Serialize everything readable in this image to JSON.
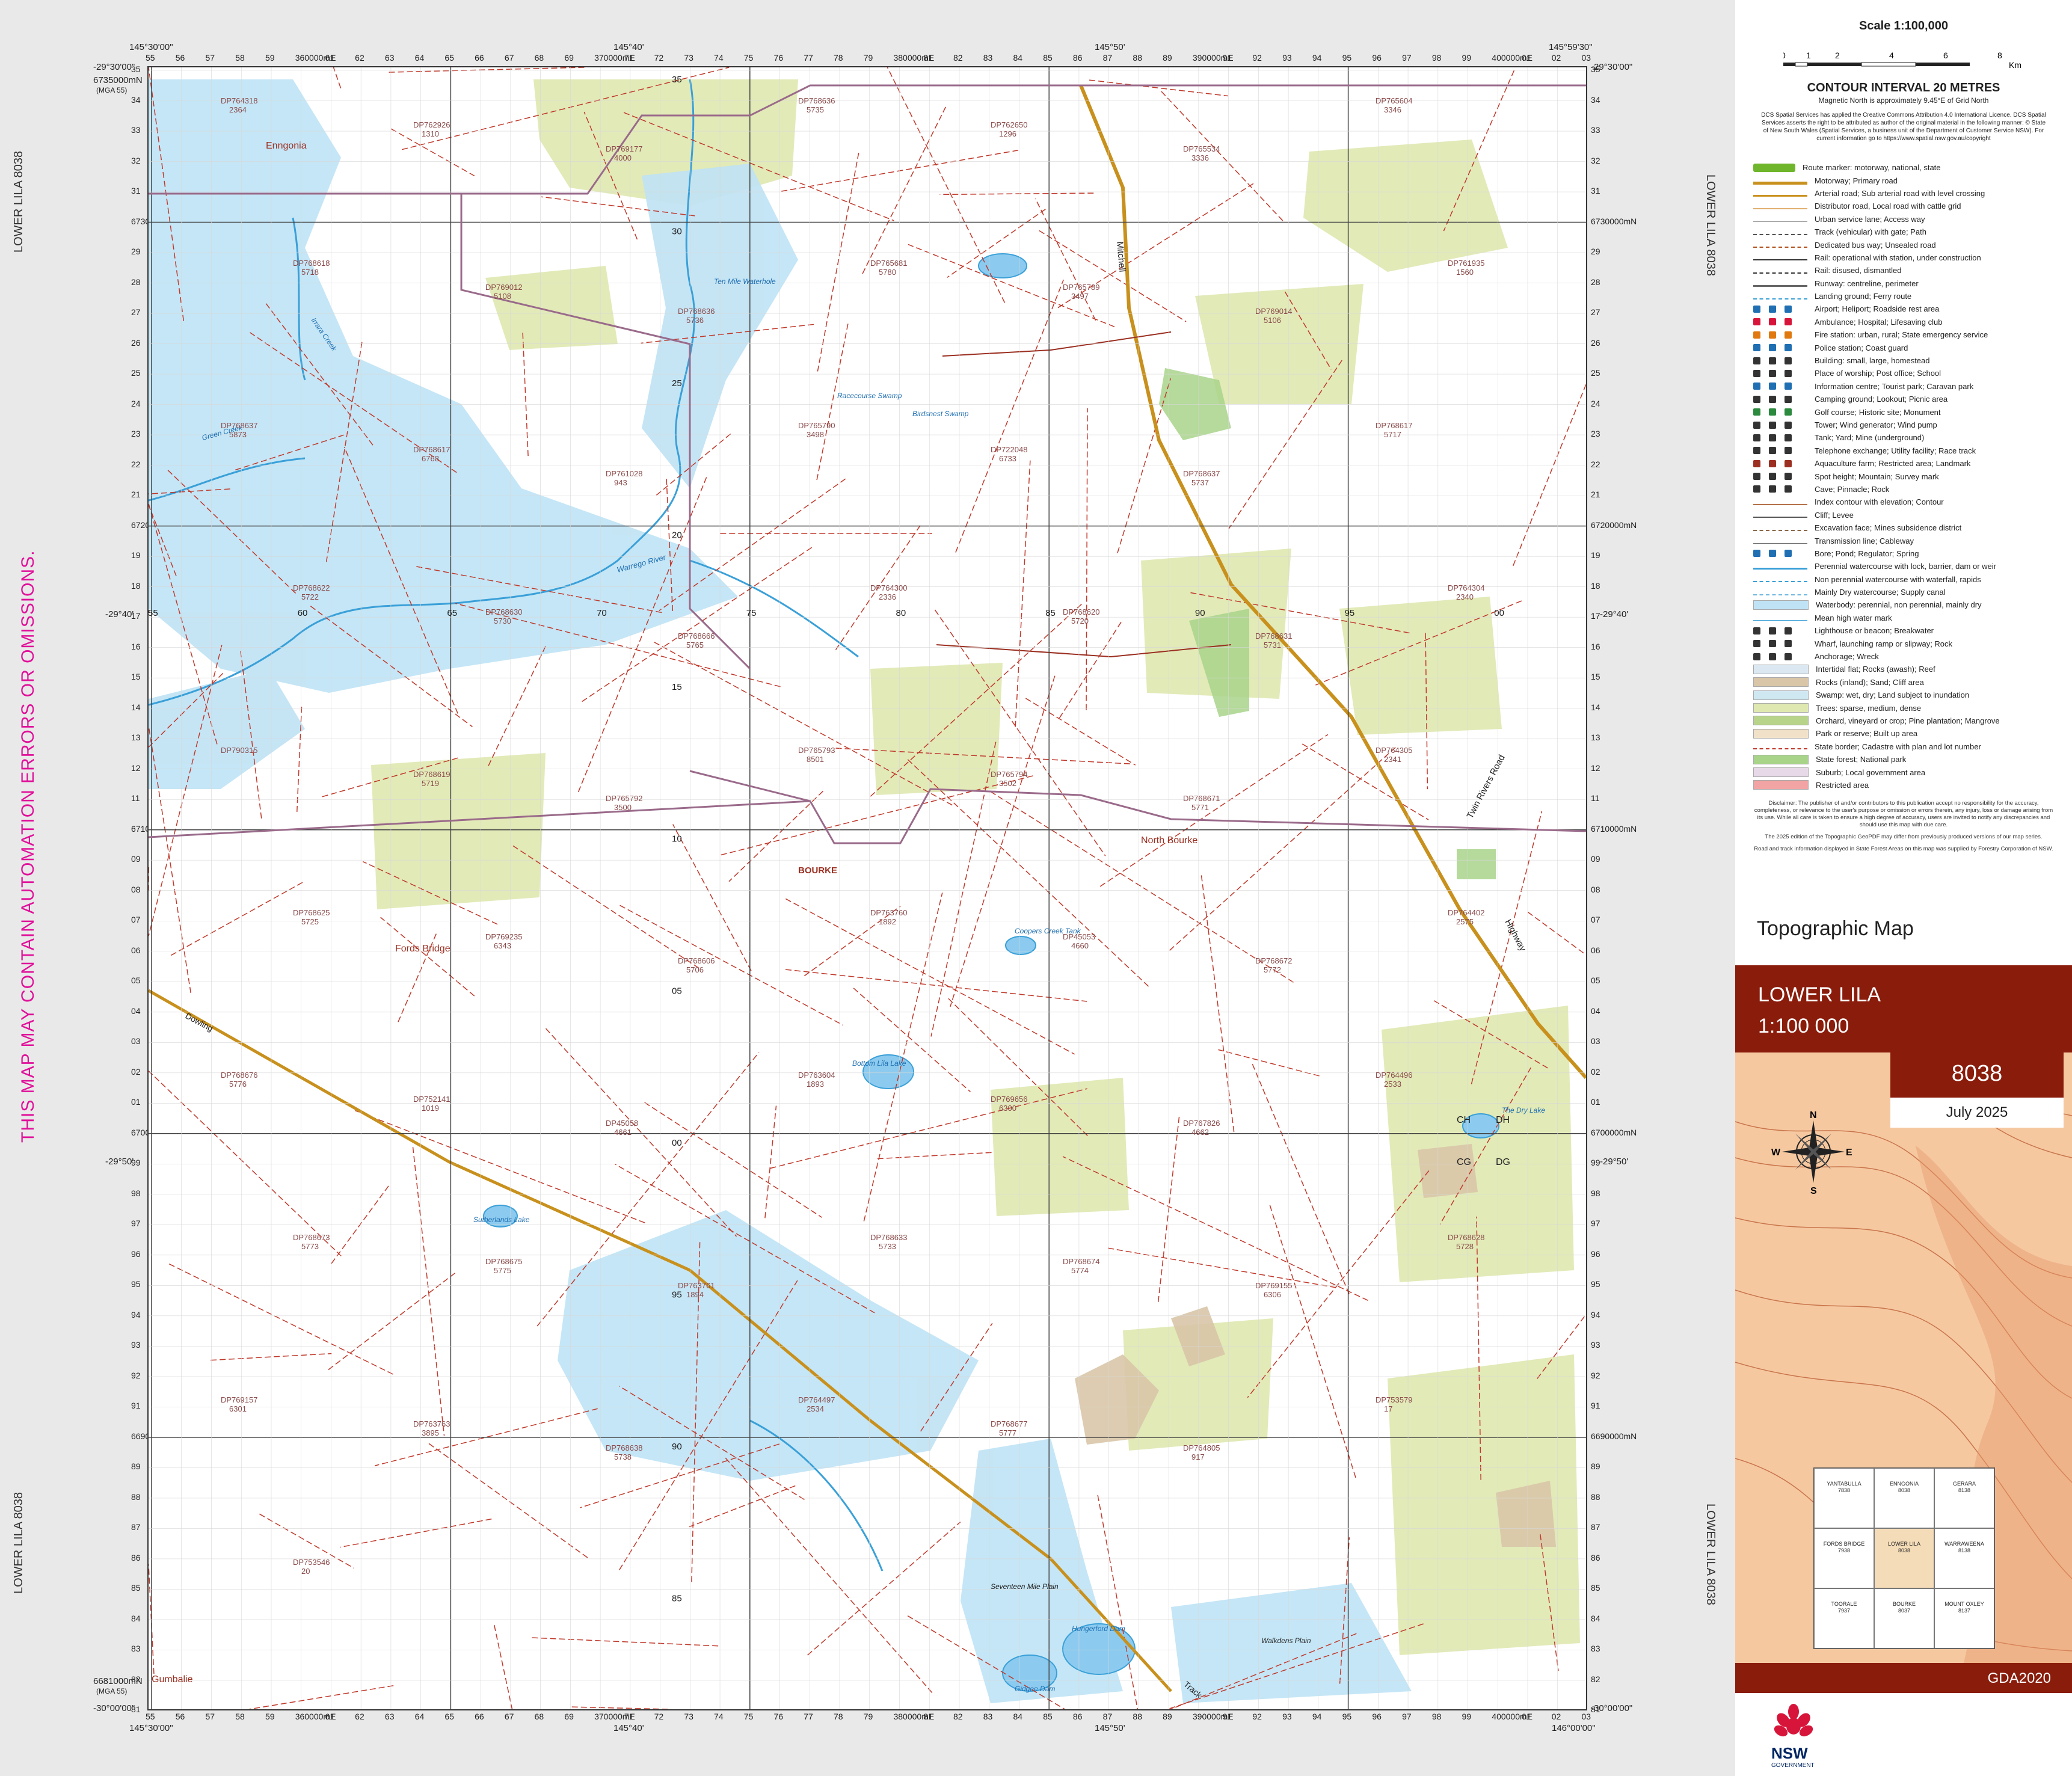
{
  "sheet": {
    "name": "LOWER LILA",
    "left_margin_label_top": "LOWER LILA 8038",
    "left_margin_label_bottom": "LOWER LILA 8038",
    "right_margin_label_top": "LOWER LILA 8038",
    "right_margin_label_bottom": "LOWER LILA 8038",
    "warning": "THIS MAP MAY CONTAIN AUTOMATION ERRORS OR OMISSIONS."
  },
  "corners": {
    "top_left_lon": "145°30'00\"",
    "top_right_lon": "145°59'30\"",
    "bottom_left_lon": "145°30'00\"",
    "bottom_right_lon": "146°00'00\"",
    "top_left_lat": "-29°30'00\"",
    "top_right_lat": "-29°30'00\"",
    "bottom_left_lat": "-30°00'00\"",
    "bottom_right_lat": "-30°00'00\"",
    "top_north": "6735000mN",
    "top_north_note": "(MGA 55)",
    "bottom_north": "6681000mN",
    "bottom_north_note": "(MGA 55)",
    "mid_top_lon_1": "145°40'",
    "mid_top_lon_2": "145°50'",
    "mid_bottom_lon_1": "145°40'",
    "mid_bottom_lon_2": "145°50'",
    "mid_left_lat_1": "-29°40'",
    "mid_left_lat_2": "-29°50'",
    "mid_right_lat_1": "-29°40'",
    "mid_right_lat_2": "-29°50'"
  },
  "eastings": [
    "55",
    "56",
    "57",
    "58",
    "59",
    "360000mE",
    "61",
    "62",
    "63",
    "64",
    "65",
    "66",
    "67",
    "68",
    "69",
    "370000mE",
    "71",
    "72",
    "73",
    "74",
    "75",
    "76",
    "77",
    "78",
    "79",
    "380000mE",
    "81",
    "82",
    "83",
    "84",
    "85",
    "86",
    "87",
    "88",
    "89",
    "390000mE",
    "91",
    "92",
    "93",
    "94",
    "95",
    "96",
    "97",
    "98",
    "99",
    "400000mE",
    "01",
    "02",
    "03"
  ],
  "northings": [
    "35",
    "34",
    "33",
    "32",
    "31",
    "6730000mN",
    "29",
    "28",
    "27",
    "26",
    "25",
    "24",
    "23",
    "22",
    "21",
    "6720000mN",
    "19",
    "18",
    "17",
    "16",
    "15",
    "14",
    "13",
    "12",
    "11",
    "6710000mN",
    "09",
    "08",
    "07",
    "06",
    "05",
    "04",
    "03",
    "02",
    "01",
    "6700000mN",
    "99",
    "98",
    "97",
    "96",
    "95",
    "94",
    "93",
    "92",
    "91",
    "6690000mN",
    "89",
    "88",
    "87",
    "86",
    "85",
    "84",
    "83",
    "82",
    "81"
  ],
  "places": {
    "enngonia": "Enngonia",
    "fords_bridge": "Fords Bridge",
    "bourke": "BOURKE",
    "north_bourke": "North Bourke",
    "gumbalie": "Gumbalie",
    "ten_mile_waterhole": "Ten Mile Waterhole",
    "racecourse_swamp": "Racecourse Swamp",
    "birdsnest_swamp": "Birdsnest Swamp",
    "coopers_creek_tank": "Coopers Creek Tank",
    "bottom_lila_lake": "Bottom Lila Lake",
    "sutherlands_lake": "Sutherlands Lake",
    "seventeen_mile_plain": "Seventeen Mile Plain",
    "hungerford_dam": "Hungerford Dam",
    "gidgee_dam": "Gidgee Dam",
    "walkdens_plain": "Walkdens Plain",
    "the_dry_lake": "The Dry Lake",
    "green_creek": "Green Creek",
    "irrara_creek": "Irrara Creek",
    "warrego_river": "Warrego River",
    "mitchell_hwy": "Mitchell",
    "highway": "Highway",
    "twin_rivers_road": "Twin Rivers Road",
    "dowling": "Dowling",
    "track": "Track",
    "cg": "CG",
    "dg": "DG",
    "ch": "CH",
    "dh": "DH"
  },
  "lots": [
    {
      "id": "DP764318",
      "num": "2364"
    },
    {
      "id": "DP762926",
      "num": "1310"
    },
    {
      "id": "DP769177",
      "num": "4000"
    },
    {
      "id": "DP768636",
      "num": "5735"
    },
    {
      "id": "DP762650",
      "num": "1296"
    },
    {
      "id": "DP765534",
      "num": "3336"
    },
    {
      "id": "DP765604",
      "num": "3346"
    },
    {
      "id": "DP768618",
      "num": "5718"
    },
    {
      "id": "DP769012",
      "num": "5108"
    },
    {
      "id": "DP768636",
      "num": "5736"
    },
    {
      "id": "DP765681",
      "num": "5780"
    },
    {
      "id": "DP765789",
      "num": "3497"
    },
    {
      "id": "DP769014",
      "num": "5106"
    },
    {
      "id": "DP761935",
      "num": "1560"
    },
    {
      "id": "DP768637",
      "num": "5873"
    },
    {
      "id": "DP768617",
      "num": "6768"
    },
    {
      "id": "DP761028",
      "num": "943"
    },
    {
      "id": "DP765790",
      "num": "3498"
    },
    {
      "id": "DP722048",
      "num": "6733"
    },
    {
      "id": "DP768637",
      "num": "5737"
    },
    {
      "id": "DP768617",
      "num": "5717"
    },
    {
      "id": "DP768622",
      "num": "5722"
    },
    {
      "id": "DP768630",
      "num": "5730"
    },
    {
      "id": "DP768666",
      "num": "5765"
    },
    {
      "id": "DP764300",
      "num": "2336"
    },
    {
      "id": "DP768620",
      "num": "5720"
    },
    {
      "id": "DP768631",
      "num": "5731"
    },
    {
      "id": "DP764304",
      "num": "2340"
    },
    {
      "id": "DP790315",
      "num": ""
    },
    {
      "id": "DP768619",
      "num": "5719"
    },
    {
      "id": "DP765792",
      "num": "3500"
    },
    {
      "id": "DP765793",
      "num": "8501"
    },
    {
      "id": "DP765794",
      "num": "3502"
    },
    {
      "id": "DP768671",
      "num": "5771"
    },
    {
      "id": "DP764305",
      "num": "2341"
    },
    {
      "id": "DP768625",
      "num": "5725"
    },
    {
      "id": "DP769235",
      "num": "6343"
    },
    {
      "id": "DP768606",
      "num": "5706"
    },
    {
      "id": "DP763760",
      "num": "1892"
    },
    {
      "id": "DP45053",
      "num": "4660"
    },
    {
      "id": "DP768672",
      "num": "5772"
    },
    {
      "id": "DP764402",
      "num": "2575"
    },
    {
      "id": "DP768676",
      "num": "5776"
    },
    {
      "id": "DP752141",
      "num": "1019"
    },
    {
      "id": "DP45058",
      "num": "4661"
    },
    {
      "id": "DP763604",
      "num": "1893"
    },
    {
      "id": "DP769656",
      "num": "6300"
    },
    {
      "id": "DP767826",
      "num": "4662"
    },
    {
      "id": "DP764496",
      "num": "2533"
    },
    {
      "id": "DP768673",
      "num": "5773"
    },
    {
      "id": "DP768675",
      "num": "5775"
    },
    {
      "id": "DP763761",
      "num": "1894"
    },
    {
      "id": "DP768633",
      "num": "5733"
    },
    {
      "id": "DP768674",
      "num": "5774"
    },
    {
      "id": "DP769155",
      "num": "6306"
    },
    {
      "id": "DP768628",
      "num": "5728"
    },
    {
      "id": "DP769157",
      "num": "6301"
    },
    {
      "id": "DP763763",
      "num": "3895"
    },
    {
      "id": "DP768638",
      "num": "5738"
    },
    {
      "id": "DP764497",
      "num": "2534"
    },
    {
      "id": "DP768677",
      "num": "5777"
    },
    {
      "id": "DP764805",
      "num": "917"
    },
    {
      "id": "DP753579",
      "num": "17"
    },
    {
      "id": "DP753546",
      "num": "20"
    }
  ],
  "grid_labels": {
    "left_col": [
      "35",
      "30",
      "25",
      "20",
      "15",
      "10",
      "05",
      "00",
      "95",
      "90",
      "85"
    ],
    "inner": [
      "55",
      "60",
      "65",
      "70",
      "75",
      "80",
      "85",
      "90",
      "95",
      "00"
    ]
  },
  "panel": {
    "scale_title": "Scale 1:100,000",
    "scale_ticks": [
      "0",
      "1",
      "2",
      "4",
      "6",
      "8"
    ],
    "scale_unit": "Km",
    "contour_title": "CONTOUR INTERVAL 20 METRES",
    "magnetic_note": "Magnetic North is approximately 9.45°E of Grid North",
    "copyright_note": "DCS Spatial Services has applied the Creative Commons Attribution 4.0 International Licence. DCS Spatial Services asserts the right to be attributed as author of the original material in the following manner: © State of New South Wales (Spatial Services, a business unit of the Department of Customer Service NSW). For current information go to https://www.spatial.nsw.gov.au/copyright",
    "legend": [
      "Route marker: motorway, national, state",
      "Motorway; Primary road",
      "Arterial road; Sub arterial road with level crossing",
      "Distributor road, Local road with cattle grid",
      "Urban service lane; Access way",
      "Track (vehicular) with gate; Path",
      "Dedicated bus way; Unsealed road",
      "Rail: operational with station, under construction",
      "Rail: disused, dismantled",
      "Runway: centreline, perimeter",
      "Landing ground; Ferry route",
      "Airport; Heliport; Roadside rest area",
      "Ambulance; Hospital; Lifesaving club",
      "Fire station: urban, rural; State emergency service",
      "Police station; Coast guard",
      "Building: small, large, homestead",
      "Place of worship; Post office; School",
      "Information centre; Tourist park; Caravan park",
      "Camping ground; Lookout; Picnic area",
      "Golf course; Historic site; Monument",
      "Tower; Wind generator; Wind pump",
      "Tank; Yard; Mine (underground)",
      "Telephone exchange; Utility facility; Race track",
      "Aquaculture farm; Restricted area; Landmark",
      "Spot height; Mountain; Survey mark",
      "Cave; Pinnacle; Rock",
      "Index contour with elevation; Contour",
      "Cliff; Levee",
      "Excavation face; Mines subsidence district",
      "Transmission line; Cableway",
      "Bore; Pond; Regulator; Spring",
      "Perennial watercourse with lock, barrier, dam or weir",
      "Non perennial watercourse with waterfall, rapids",
      "Mainly Dry watercourse; Supply canal",
      "Waterbody: perennial, non perennial, mainly dry",
      "Mean high water mark",
      "Lighthouse or beacon; Breakwater",
      "Wharf, launching ramp or slipway; Rock",
      "Anchorage; Wreck",
      "Intertidal flat; Rocks (awash); Reef",
      "Rocks (inland); Sand; Cliff area",
      "Swamp: wet, dry; Land subject to inundation",
      "Trees: sparse, medium, dense",
      "Orchard, vineyard or crop; Pine plantation; Mangrove",
      "Park or reserve; Built up area",
      "State border; Cadastre with plan and lot number",
      "State forest; National park",
      "Suburb; Local government area",
      "Restricted area"
    ],
    "disclaimer": "Disclaimer: The publisher of and/or contributors to this publication accept no responsibility for the accuracy, completeness, or relevance to the user's purpose or omission or errors therein, any injury, loss or damage arising from its use. While all care is taken to ensure a high degree of accuracy, users are invited to notify any discrepancies and should use this map with due care.",
    "disclaimer2": "The 2025 edition of the Topographic GeoPDF may differ from previously produced versions of our map series.",
    "disclaimer3": "Road and track information displayed in State Forest Areas on this map was supplied by Forestry Corporation of NSW.",
    "topo_title": "Topographic Map",
    "map_name": "LOWER LILA",
    "map_scale": "1:100 000",
    "sheet_number": "8038",
    "date": "July 2025",
    "compass": {
      "n": "N",
      "s": "S",
      "e": "E",
      "w": "W"
    },
    "index": [
      {
        "name": "YANTABULLA",
        "num": "7838"
      },
      {
        "name": "ENNGONIA",
        "num": "8038"
      },
      {
        "name": "GERARA",
        "num": "8138"
      },
      {
        "name": "FORDS BRIDGE",
        "num": "7938"
      },
      {
        "name": "LOWER LILA",
        "num": "8038"
      },
      {
        "name": "WARRAWEENA",
        "num": "8138"
      },
      {
        "name": "TOORALE",
        "num": "7937"
      },
      {
        "name": "BOURKE",
        "num": "8037"
      },
      {
        "name": "MOUNT OXLEY",
        "num": "8137"
      }
    ],
    "datum": "GDA2020",
    "logo_text": "NSW",
    "logo_sub": "GOVERNMENT"
  },
  "colors": {
    "water": "#bfe3f5",
    "water_line": "#3aa0d8",
    "road_major": "#c8901c",
    "cadastre": "#c0392b",
    "veg": "#dfe8b0",
    "park": "#a8d48a",
    "brand": "#8a1c0c",
    "warning": "#e0109a"
  }
}
